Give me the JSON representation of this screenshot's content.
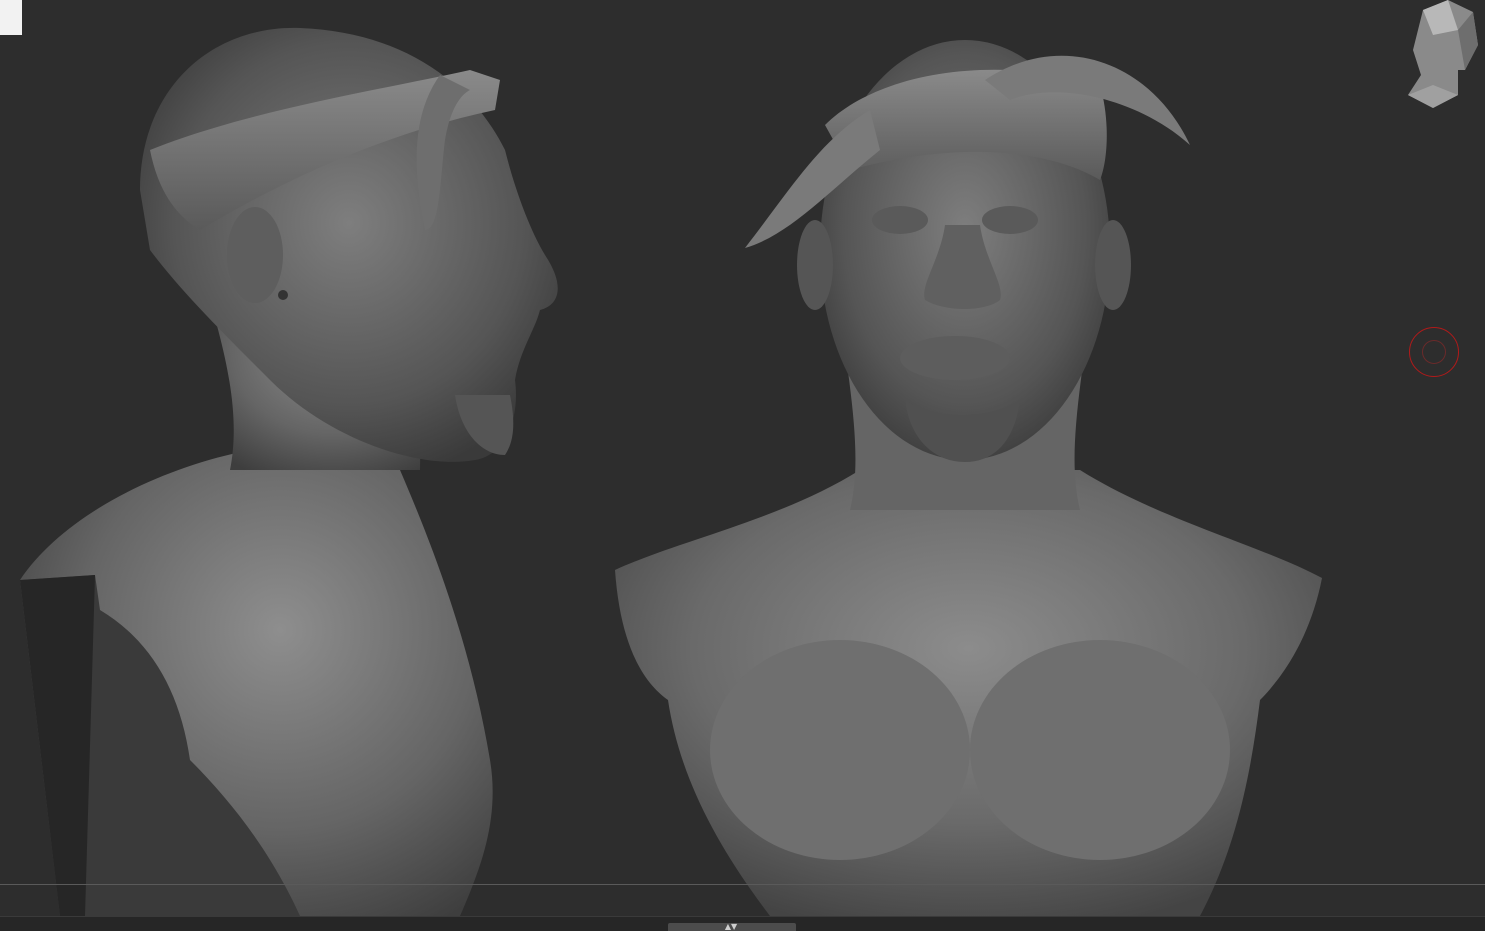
{
  "viewport": {
    "background": "#2d2d2d",
    "floor_line_color": "#5a5a5a"
  },
  "scene": {
    "objects": [
      {
        "name": "side-view-bust",
        "material": "matcap-gray"
      },
      {
        "name": "front-view-bust",
        "material": "matcap-gray"
      }
    ]
  },
  "icons": {
    "navigation": "head-gizmo-icon",
    "brush": "brush-cursor-icon",
    "tray": "tray-toggle-icon"
  },
  "colors": {
    "brush_ring": "#b01a1a",
    "sculpt_base": "#6a6a6a",
    "sculpt_light": "#9a9a9a",
    "sculpt_dark": "#3a3a3a"
  },
  "tray": {
    "arrow": "▲▼"
  }
}
